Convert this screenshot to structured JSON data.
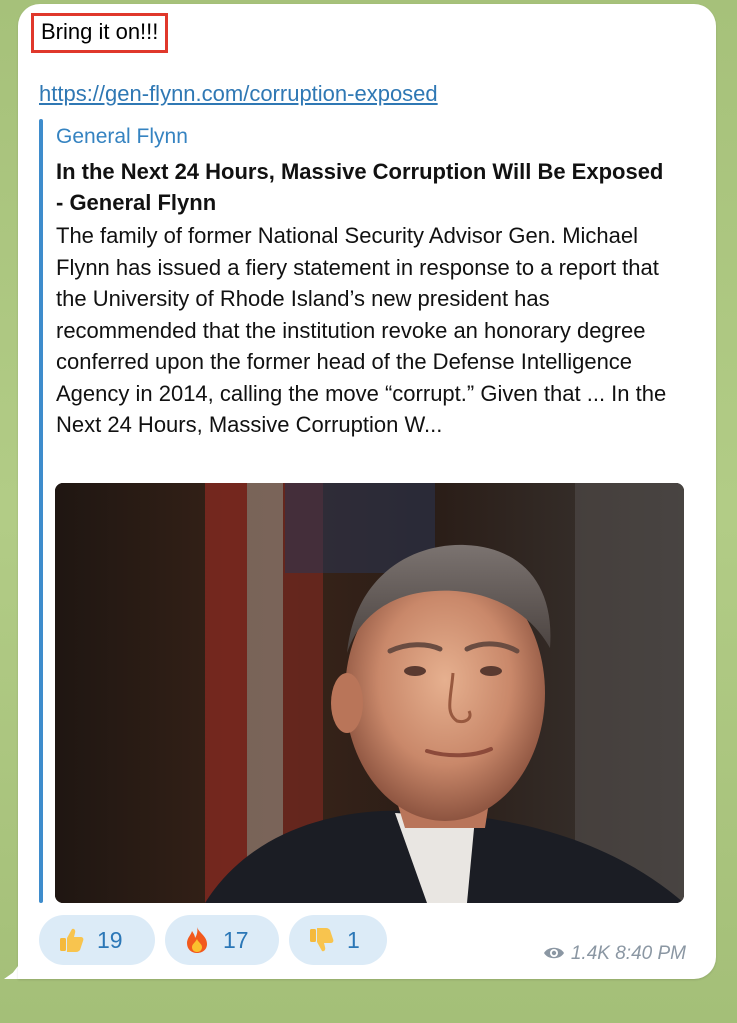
{
  "message": {
    "text": "Bring it on!!!",
    "link": "https://gen-flynn.com/corruption-exposed",
    "link_preview": {
      "site_name": "General Flynn",
      "title": "In the Next 24 Hours, Massive Corruption Will Be Exposed - General Flynn",
      "description": "The family of former National Security Advisor Gen. Michael Flynn has issued a fiery statement in response to a report that the University of Rhode Island’s new president has recommended that the institution revoke an honorary degree conferred upon the former head of the Defense Intelligence Agency in 2014, calling the move “corrupt.” Given that ... In the Next 24 Hours, Massive Corruption W..."
    },
    "reactions": [
      {
        "emoji": "thumbs-up",
        "count": "19"
      },
      {
        "emoji": "fire",
        "count": "17"
      },
      {
        "emoji": "thumbs-down",
        "count": "1"
      }
    ],
    "views": "1.4K",
    "time": "8:40 PM"
  },
  "colors": {
    "chat_background": "#a9c37c",
    "bubble": "#ffffff",
    "link": "#2f78b4",
    "accent_bar": "#3e8ccc",
    "highlight_box": "#e0382b",
    "reaction_pill": "#dcebf7"
  }
}
